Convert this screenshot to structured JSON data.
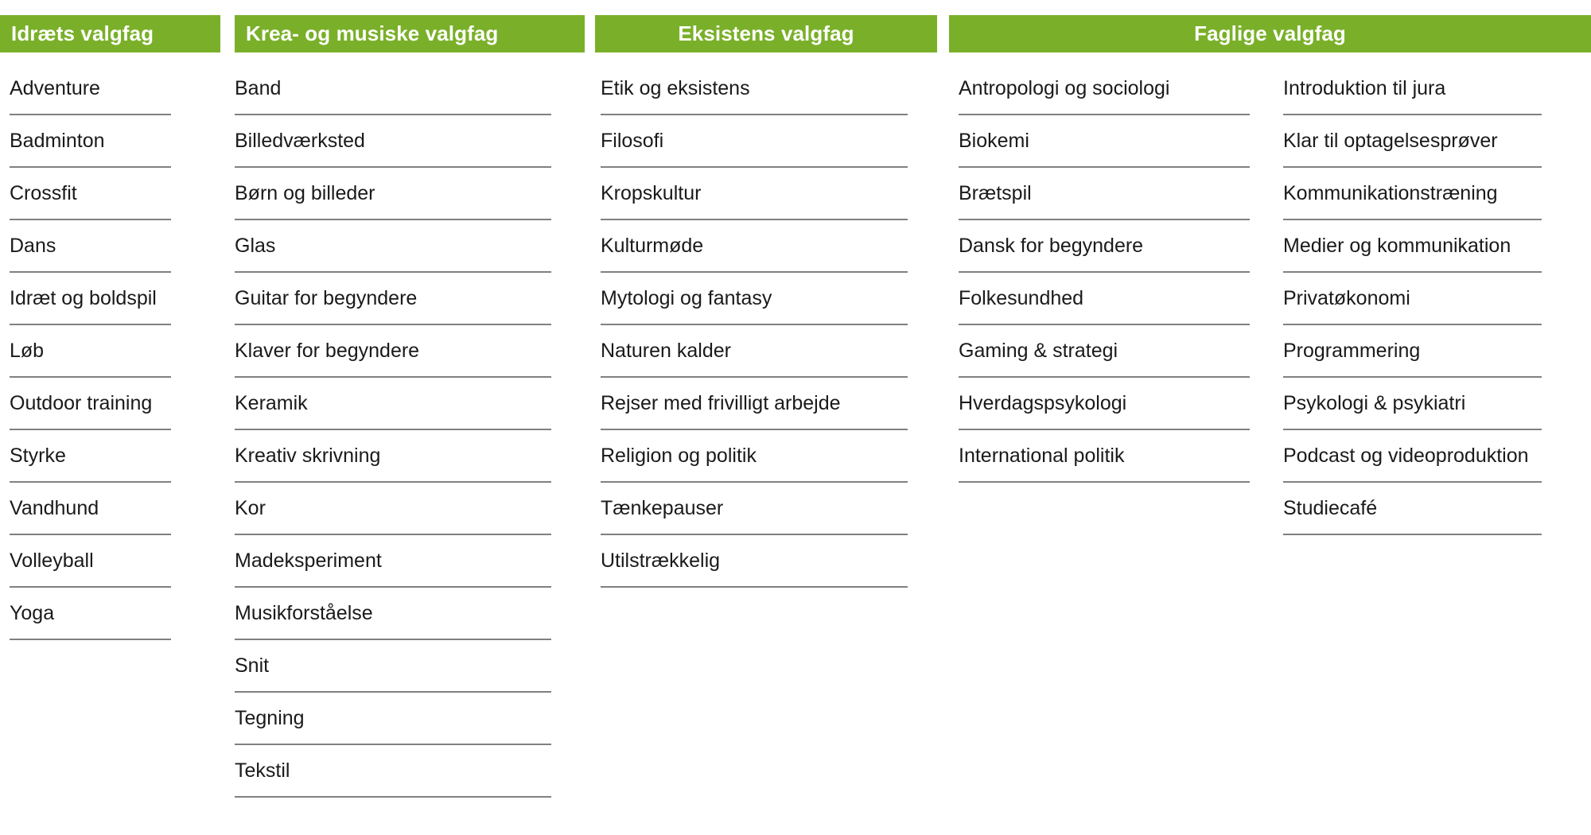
{
  "page": {
    "title": "Valgfag oversigt",
    "accent_color": "#7ab029",
    "divider_color": "#808080",
    "text_color": "#1a1a1a",
    "header_text_color": "#ffffff",
    "background_color": "#ffffff"
  },
  "categories": [
    {
      "id": "idraets-valgfag",
      "header": "Idræts valgfag",
      "header_align": "left",
      "columns": [
        {
          "id": "idraet-col-1",
          "items": [
            "Adventure",
            "Badminton",
            "Crossfit",
            "Dans",
            "Idræt og boldspil",
            "Løb",
            "Outdoor training",
            "Styrke",
            "Vandhund",
            "Volleyball",
            "Yoga"
          ]
        }
      ]
    },
    {
      "id": "krea-og-musiske-valgfag",
      "header": "Krea- og musiske valgfag",
      "header_align": "left",
      "columns": [
        {
          "id": "krea-col-1",
          "items": [
            "Band",
            "Billedværksted",
            "Børn og billeder",
            "Glas",
            "Guitar for begyndere",
            "Klaver for begyndere",
            "Keramik",
            "Kreativ skrivning",
            "Kor",
            "Madeksperiment",
            "Musikforståelse",
            "Snit",
            "Tegning",
            "Tekstil"
          ]
        }
      ]
    },
    {
      "id": "eksistens-valgfag",
      "header": "Eksistens valgfag",
      "header_align": "center",
      "columns": [
        {
          "id": "eksistens-col-1",
          "items": [
            "Etik og eksistens",
            "Filosofi",
            "Kropskultur",
            "Kulturmøde",
            "Mytologi og fantasy",
            "Naturen kalder",
            "Rejser med frivilligt arbejde",
            "Religion og politik",
            "Tænkepauser",
            "Utilstrækkelig"
          ]
        }
      ]
    },
    {
      "id": "faglige-valgfag",
      "header": "Faglige valgfag",
      "header_align": "center",
      "columns": [
        {
          "id": "faglige-col-1",
          "items": [
            "Antropologi og sociologi",
            "Biokemi",
            "Brætspil",
            "Dansk for begyndere",
            "Folkesundhed",
            "Gaming & strategi",
            "Hverdagspsykologi",
            "International politik"
          ]
        },
        {
          "id": "faglige-col-2",
          "items": [
            "Introduktion til jura",
            "Klar til optagelsesprøver",
            "Kommunikationstræning",
            "Medier og kommunikation",
            "Privatøkonomi",
            "Programmering",
            "Psykologi & psykiatri",
            "Podcast og videoproduktion",
            "Studiecafé"
          ]
        }
      ]
    }
  ]
}
